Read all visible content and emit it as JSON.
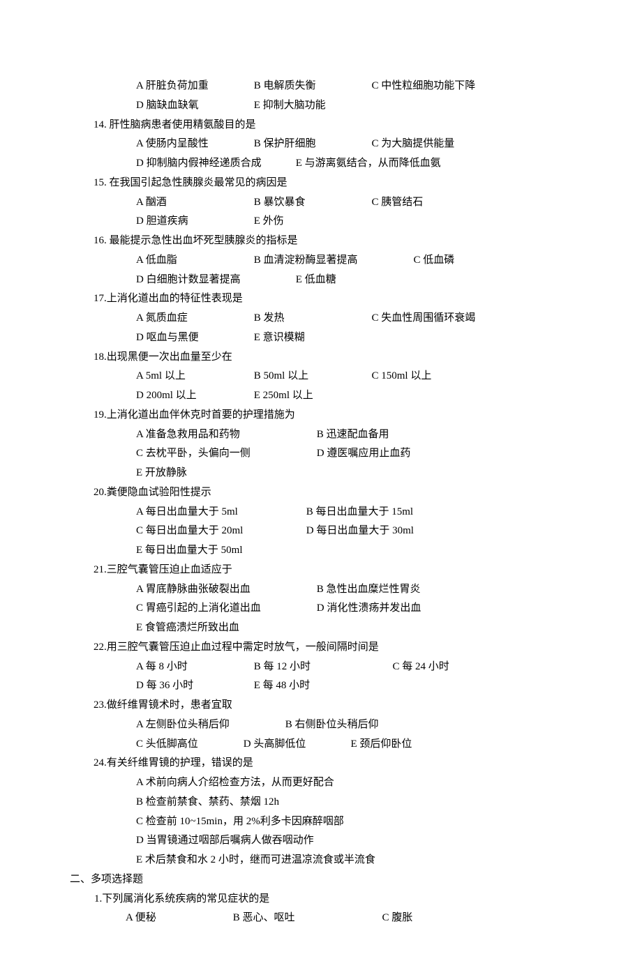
{
  "q13_optA": "A 肝脏负荷加重",
  "q13_optB": "B 电解质失衡",
  "q13_optC": "C 中性粒细胞功能下降",
  "q13_optD": "D 脑缺血缺氧",
  "q13_optE": "E 抑制大脑功能",
  "q14_stem": "14. 肝性脑病患者使用精氨酸目的是",
  "q14_optA": "A 使肠内呈酸性",
  "q14_optB": "B 保护肝细胞",
  "q14_optC": "C 为大脑提供能量",
  "q14_optD": "D 抑制脑内假神经递质合成",
  "q14_optE": "E 与游离氨结合，从而降低血氨",
  "q15_stem": "15. 在我国引起急性胰腺炎最常见的病因是",
  "q15_optA": "A 酗酒",
  "q15_optB": "B 暴饮暴食",
  "q15_optC": "C 胰管结石",
  "q15_optD": "D 胆道疾病",
  "q15_optE": "E 外伤",
  "q16_stem": "16. 最能提示急性出血坏死型胰腺炎的指标是",
  "q16_optA": "A 低血脂",
  "q16_optB": "B 血清淀粉酶显著提高",
  "q16_optC": "C 低血磷",
  "q16_optD": "D 白细胞计数显著提高",
  "q16_optE": "E 低血糖",
  "q17_stem": "17.上消化道出血的特征性表现是",
  "q17_optA": "A 氮质血症",
  "q17_optB": "B 发热",
  "q17_optC": "C 失血性周围循环衰竭",
  "q17_optD": "D 呕血与黑便",
  "q17_optE": "E 意识模糊",
  "q18_stem": "18.出现黑便一次出血量至少在",
  "q18_optA": "A 5ml 以上",
  "q18_optB": "B 50ml 以上",
  "q18_optC": "C 150ml 以上",
  "q18_optD": "D 200ml 以上",
  "q18_optE": "E 250ml  以上",
  "q19_stem": "19.上消化道出血伴休克时首要的护理措施为",
  "q19_optA": "A 准备急救用品和药物",
  "q19_optB": "B 迅速配血备用",
  "q19_optC": "C 去枕平卧，头偏向一侧",
  "q19_optD": "D 遵医嘱应用止血药",
  "q19_optE": "E 开放静脉",
  "q20_stem": "20.粪便隐血试验阳性提示",
  "q20_optA": "A 每日出血量大于 5ml",
  "q20_optB": "B 每日出血量大于 15ml",
  "q20_optC": "C 每日出血量大于 20ml",
  "q20_optD": "D 每日出血量大于 30ml",
  "q20_optE": "E 每日出血量大于 50ml",
  "q21_stem": "21.三腔气囊管压迫止血适应于",
  "q21_optA": "A 胃底静脉曲张破裂出血",
  "q21_optB": "B 急性出血糜烂性胃炎",
  "q21_optC": "C 胃癌引起的上消化道出血",
  "q21_optD": "D 消化性溃疡并发出血",
  "q21_optE": "E 食管癌溃烂所致出血",
  "q22_stem": "22.用三腔气囊管压迫止血过程中需定时放气，一般间隔时间是",
  "q22_optA": "A 每 8 小时",
  "q22_optB": "B 每 12 小时",
  "q22_optC": "C 每 24 小时",
  "q22_optD": "D 每 36 小时",
  "q22_optE": "E 每 48 小时",
  "q23_stem": "23.做纤维胃镜术时，患者宜取",
  "q23_optA": "A 左侧卧位头稍后仰",
  "q23_optB": "B 右侧卧位头稍后仰",
  "q23_optC": "C 头低脚高位",
  "q23_optD": "D 头高脚低位",
  "q23_optE": "E 颈后仰卧位",
  "q24_stem": "24.有关纤维胃镜的护理，错误的是",
  "q24_optA": "A 术前向病人介绍检查方法，从而更好配合",
  "q24_optB": "B 检查前禁食、禁药、禁烟 12h",
  "q24_optC": "C 检查前 10~15min，用 2%利多卡因麻醉咽部",
  "q24_optD": "D 当胃镜通过咽部后嘱病人做吞咽动作",
  "q24_optE": "E 术后禁食和水 2 小时，继而可进温凉流食或半流食",
  "sec2_title": "二、多项选择题",
  "s2q1_stem": "1.下列属消化系统疾病的常见症状的是",
  "s2q1_optA": "A 便秘",
  "s2q1_optB": "B 恶心、呕吐",
  "s2q1_optC": "C 腹胀"
}
